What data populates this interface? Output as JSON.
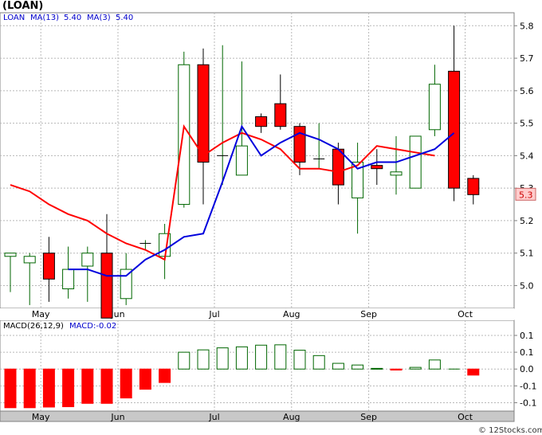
{
  "ticker_title": "(LOAN)",
  "watermark": "© 12Stocks.com",
  "price_panel": {
    "legend": {
      "symbol": "LOAN",
      "ma13_label": "MA(13)",
      "ma13_value": "5.40",
      "ma3_label": "MA(3)",
      "ma3_value": "5.40"
    },
    "last_price_badge": "5.3"
  },
  "macd_panel": {
    "label": "MACD(26,12,9)",
    "value_label": "MACD:-0.02"
  },
  "colors": {
    "up_candle_body": "#ffffff",
    "up_candle_border": "#006600",
    "down_candle": "#ff0000",
    "ma13": "#ff0000",
    "ma3": "#0000dd",
    "macd_positive_fill": "#ffffff",
    "macd_positive_border": "#006600",
    "macd_negative": "#ff0000",
    "grid": "#b8b8b8",
    "badge_bg": "#ffcccc"
  },
  "chart_data": [
    {
      "type": "candlestick",
      "name": "price",
      "ylim": [
        4.93,
        5.84
      ],
      "yticks": [
        "5.0",
        "5.1",
        "5.2",
        "5.3",
        "5.4",
        "5.5",
        "5.6",
        "5.7",
        "5.8"
      ],
      "ytick_values": [
        5.0,
        5.1,
        5.2,
        5.3,
        5.4,
        5.5,
        5.6,
        5.7,
        5.8
      ],
      "month_labels": [
        "May",
        "Jun",
        "Jul",
        "Aug",
        "Sep",
        "Oct"
      ],
      "month_label_index": [
        1,
        5,
        10,
        14,
        18,
        23
      ],
      "grid": true,
      "candles": [
        {
          "o": 5.09,
          "h": 5.1,
          "l": 4.98,
          "c": 5.1
        },
        {
          "o": 5.07,
          "h": 5.1,
          "l": 4.94,
          "c": 5.09
        },
        {
          "o": 5.1,
          "h": 5.15,
          "l": 4.95,
          "c": 5.02
        },
        {
          "o": 4.99,
          "h": 5.12,
          "l": 4.96,
          "c": 5.05
        },
        {
          "o": 5.06,
          "h": 5.12,
          "l": 4.95,
          "c": 5.1
        },
        {
          "o": 5.1,
          "h": 5.22,
          "l": 4.9,
          "c": 4.9
        },
        {
          "o": 4.96,
          "h": 5.1,
          "l": 4.94,
          "c": 5.05
        },
        {
          "o": 5.13,
          "h": 5.14,
          "l": 5.11,
          "c": 5.13
        },
        {
          "o": 5.09,
          "h": 5.19,
          "l": 5.02,
          "c": 5.16
        },
        {
          "o": 5.25,
          "h": 5.72,
          "l": 5.24,
          "c": 5.68
        },
        {
          "o": 5.68,
          "h": 5.73,
          "l": 5.25,
          "c": 5.38
        },
        {
          "o": 5.4,
          "h": 5.74,
          "l": 5.31,
          "c": 5.4
        },
        {
          "o": 5.34,
          "h": 5.69,
          "l": 5.34,
          "c": 5.43
        },
        {
          "o": 5.52,
          "h": 5.53,
          "l": 5.47,
          "c": 5.49
        },
        {
          "o": 5.56,
          "h": 5.65,
          "l": 5.48,
          "c": 5.49
        },
        {
          "o": 5.49,
          "h": 5.5,
          "l": 5.34,
          "c": 5.38
        },
        {
          "o": 5.39,
          "h": 5.5,
          "l": 5.36,
          "c": 5.39
        },
        {
          "o": 5.42,
          "h": 5.44,
          "l": 5.25,
          "c": 5.31
        },
        {
          "o": 5.27,
          "h": 5.44,
          "l": 5.16,
          "c": 5.38
        },
        {
          "o": 5.37,
          "h": 5.42,
          "l": 5.31,
          "c": 5.36
        },
        {
          "o": 5.34,
          "h": 5.46,
          "l": 5.28,
          "c": 5.35
        },
        {
          "o": 5.3,
          "h": 5.46,
          "l": 5.3,
          "c": 5.46
        },
        {
          "o": 5.48,
          "h": 5.68,
          "l": 5.46,
          "c": 5.62
        },
        {
          "o": 5.66,
          "h": 5.8,
          "l": 5.26,
          "c": 5.3
        },
        {
          "o": 5.33,
          "h": 5.34,
          "l": 5.25,
          "c": 5.28
        }
      ],
      "ma13": [
        5.31,
        5.29,
        5.25,
        5.22,
        5.2,
        5.16,
        5.13,
        5.11,
        5.08,
        5.49,
        5.4,
        5.44,
        5.47,
        5.45,
        5.42,
        5.36,
        5.36,
        5.35,
        5.37,
        5.43,
        5.42,
        5.41,
        5.4
      ],
      "ma13_start_index": 0,
      "ma3": [
        5.05,
        5.05,
        5.03,
        5.03,
        5.08,
        5.11,
        5.15,
        5.16,
        5.32,
        5.49,
        5.4,
        5.44,
        5.47,
        5.45,
        5.42,
        5.36,
        5.38,
        5.38,
        5.4,
        5.42,
        5.47
      ],
      "ma3_start_index": 3
    },
    {
      "type": "bar",
      "name": "MACD(26,12,9)",
      "ylim": [
        -0.125,
        0.145
      ],
      "yticks": [
        "-0.1",
        "-0.0",
        "0.0",
        "0.1"
      ],
      "ytick_values": [
        -0.1,
        -0.05,
        0.0,
        0.05,
        0.1
      ],
      "ytick_text": [
        "-0.1",
        "-0.1",
        "0.0",
        "0.1",
        "0.1"
      ],
      "values": [
        -0.115,
        -0.115,
        -0.113,
        -0.112,
        -0.102,
        -0.102,
        -0.086,
        -0.06,
        -0.04,
        0.05,
        0.057,
        0.063,
        0.066,
        0.071,
        0.072,
        0.056,
        0.04,
        0.017,
        0.012,
        0.002,
        -0.003,
        0.005,
        0.027,
        0.0,
        -0.018
      ],
      "grid": true
    }
  ]
}
